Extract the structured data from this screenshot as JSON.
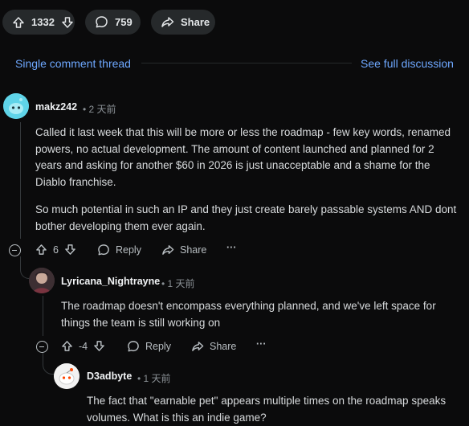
{
  "post_bar": {
    "upvotes": "1332",
    "comments": "759",
    "share_label": "Share"
  },
  "thread_nav": {
    "single_thread_label": "Single comment thread",
    "full_discussion_label": "See full discussion"
  },
  "comments": [
    {
      "author": "makz242",
      "time": "• 2 天前",
      "paragraphs": [
        "Called it last week that this will be more or less the roadmap - few key words, renamed powers, no actual development. The amount of content launched and planned for 2 years and asking for another $60 in 2026 is just unacceptable and a shame for the Diablo franchise.",
        "So much potential in such an IP and they just create barely passable systems AND dont bother developing them ever again."
      ],
      "score": "6",
      "reply_label": "Reply",
      "share_label": "Share",
      "more_label": "···"
    },
    {
      "author": "Lyricana_Nightrayne",
      "time": "• 1 天前",
      "paragraphs": [
        "The roadmap doesn't encompass everything planned, and we've left space for things the team is still working on"
      ],
      "score": "-4",
      "reply_label": "Reply",
      "share_label": "Share",
      "more_label": "···"
    },
    {
      "author": "D3adbyte",
      "time": "• 1 天前",
      "paragraphs": [
        "The fact that \"earnable pet\" appears multiple times on the roadmap speaks volumes. What is this an indie game?"
      ]
    }
  ],
  "colors": {
    "background": "#0b0b0c",
    "link": "#6ea8ff",
    "pill": "#26292b",
    "text": "#d7dadc"
  }
}
